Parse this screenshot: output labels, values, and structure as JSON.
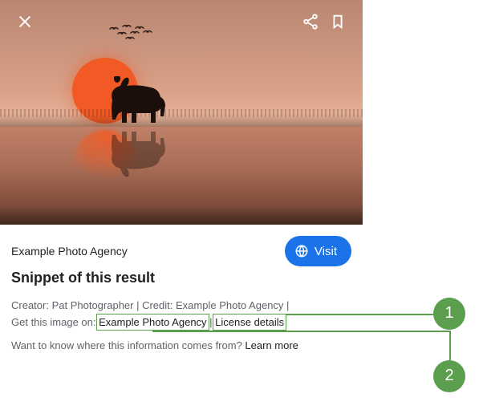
{
  "topbar": {
    "close_name": "close-icon",
    "share_name": "share-icon",
    "bookmark_name": "bookmark-icon"
  },
  "info": {
    "source": "Example Photo Agency",
    "visit_label": "Visit",
    "snippet": "Snippet of this result",
    "credits_line1_prefix": "Creator: ",
    "creator": "Pat Photographer",
    "sep": " | ",
    "credit_prefix": "Credit: ",
    "credit": "Example Photo Agency",
    "credits_line2_prefix": "Get this image on: ",
    "provider_link": "Example Photo Agency",
    "license_link": "License details",
    "want_text": "Want to know where this information comes from? ",
    "learn_more": "Learn more"
  },
  "callouts": {
    "one": "1",
    "two": "2"
  }
}
